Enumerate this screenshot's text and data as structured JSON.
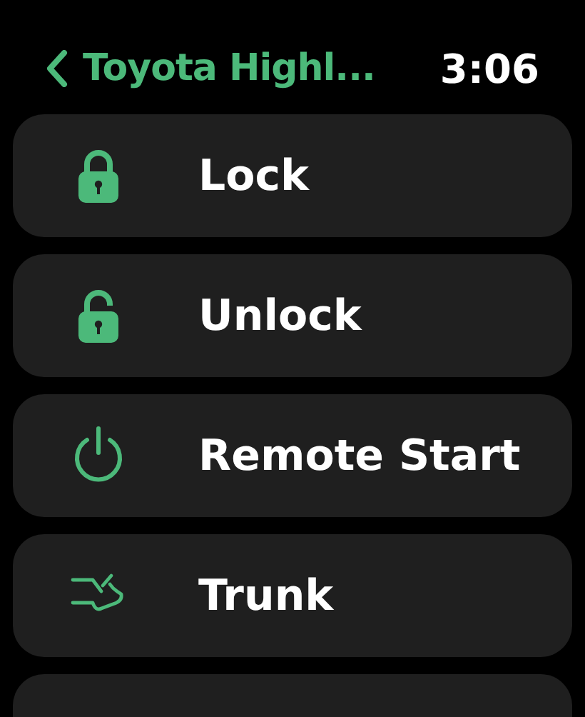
{
  "header": {
    "back_title": "Toyota Highl...",
    "time": "3:06"
  },
  "actions": [
    {
      "kind": "lock",
      "label": "Lock"
    },
    {
      "kind": "unlock",
      "label": "Unlock"
    },
    {
      "kind": "power",
      "label": "Remote Start"
    },
    {
      "kind": "trunk",
      "label": "Trunk"
    }
  ]
}
